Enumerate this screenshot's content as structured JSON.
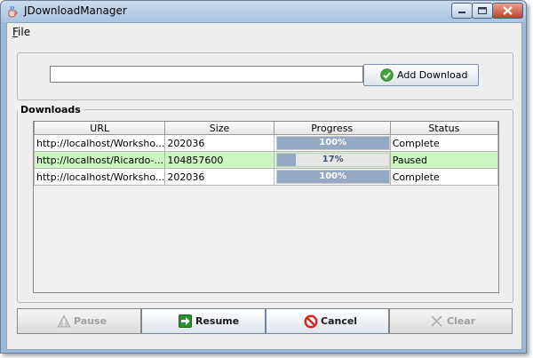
{
  "window": {
    "title": "JDownloadManager"
  },
  "menu": {
    "file_label_accel": "F",
    "file_label_rest": "ile"
  },
  "add_panel": {
    "url_value": "",
    "add_button_label": "Add Download"
  },
  "downloads": {
    "title": "Downloads",
    "columns": [
      "URL",
      "Size",
      "Progress",
      "Status"
    ],
    "rows": [
      {
        "url": "http://localhost/Worksho...",
        "size": "202036",
        "progress_text": "100%",
        "progress": 1.0,
        "status": "Complete",
        "selected": false
      },
      {
        "url": "http://localhost/Ricardo-...",
        "size": "104857600",
        "progress_text": "17%",
        "progress": 0.17,
        "status": "Paused",
        "selected": true
      },
      {
        "url": "http://localhost/Worksho...",
        "size": "202036",
        "progress_text": "100%",
        "progress": 1.0,
        "status": "Complete",
        "selected": false
      }
    ]
  },
  "actions": {
    "pause_label": "Pause",
    "pause_enabled": false,
    "resume_label": "Resume",
    "resume_enabled": true,
    "cancel_label": "Cancel",
    "cancel_enabled": true,
    "clear_label": "Clear",
    "clear_enabled": false
  },
  "icons": {
    "app": "java-cup-icon",
    "add": "green-check-icon",
    "pause": "warning-triangle-icon",
    "resume": "green-arrow-icon",
    "cancel": "red-no-icon",
    "clear": "x-icon"
  },
  "colors": {
    "selected_row": "#ccf5c2",
    "progress_fill": "#94a9c4",
    "window_frame": "#a9c4e0"
  }
}
